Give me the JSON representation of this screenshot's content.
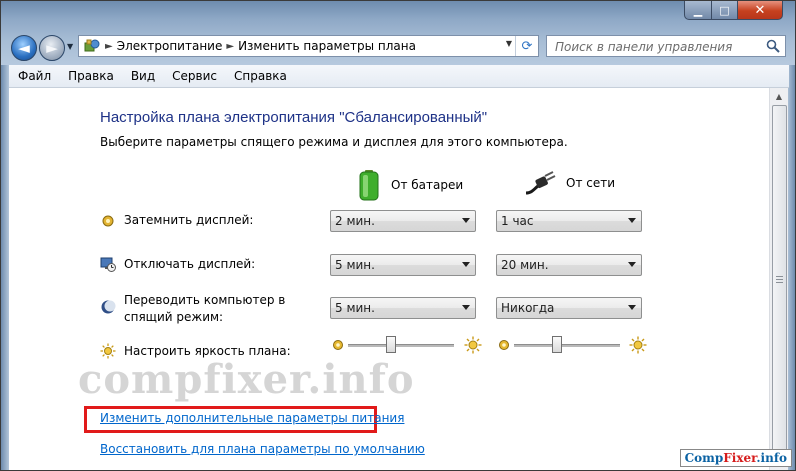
{
  "window": {
    "min_symbol": "▁",
    "max_symbol": "□",
    "close_symbol": "✕"
  },
  "nav": {
    "back_glyph": "◄",
    "forward_glyph": "►"
  },
  "address": {
    "separator": "►",
    "crumbs": [
      "Электропитание",
      "Изменить параметры плана"
    ]
  },
  "search": {
    "placeholder": "Поиск в панели управления"
  },
  "menu": [
    "Файл",
    "Правка",
    "Вид",
    "Сервис",
    "Справка"
  ],
  "page": {
    "title": "Настройка плана электропитания \"Сбалансированный\"",
    "subtitle": "Выберите параметры спящего режима и дисплея для этого компьютера."
  },
  "columns": {
    "battery": "От батареи",
    "plugged": "От сети"
  },
  "rows": [
    {
      "label": "Затемнить дисплей:",
      "icon": "dim-display-icon",
      "battery": "2 мин.",
      "plugged": "1 час"
    },
    {
      "label": "Отключать дисплей:",
      "icon": "display-off-icon",
      "battery": "5 мин.",
      "plugged": "20 мин."
    },
    {
      "label": "Переводить компьютер в спящий режим:",
      "icon": "sleep-moon-icon",
      "battery": "5 мин.",
      "plugged": "Никогда"
    }
  ],
  "brightness": {
    "label": "Настроить яркость плана:",
    "battery_level_percent": 40,
    "plugged_level_percent": 40
  },
  "links": {
    "advanced": "Изменить дополнительные параметры питания",
    "restore": "Восстановить для плана параметры по умолчанию"
  },
  "watermark": "compfixer.info",
  "brand": {
    "part1": "Comp",
    "part2": "Fixer",
    "part3": ".info"
  },
  "colors": {
    "title_blue": "#1e3287",
    "link_blue": "#0066cc",
    "highlight_red": "#e11a1a"
  }
}
